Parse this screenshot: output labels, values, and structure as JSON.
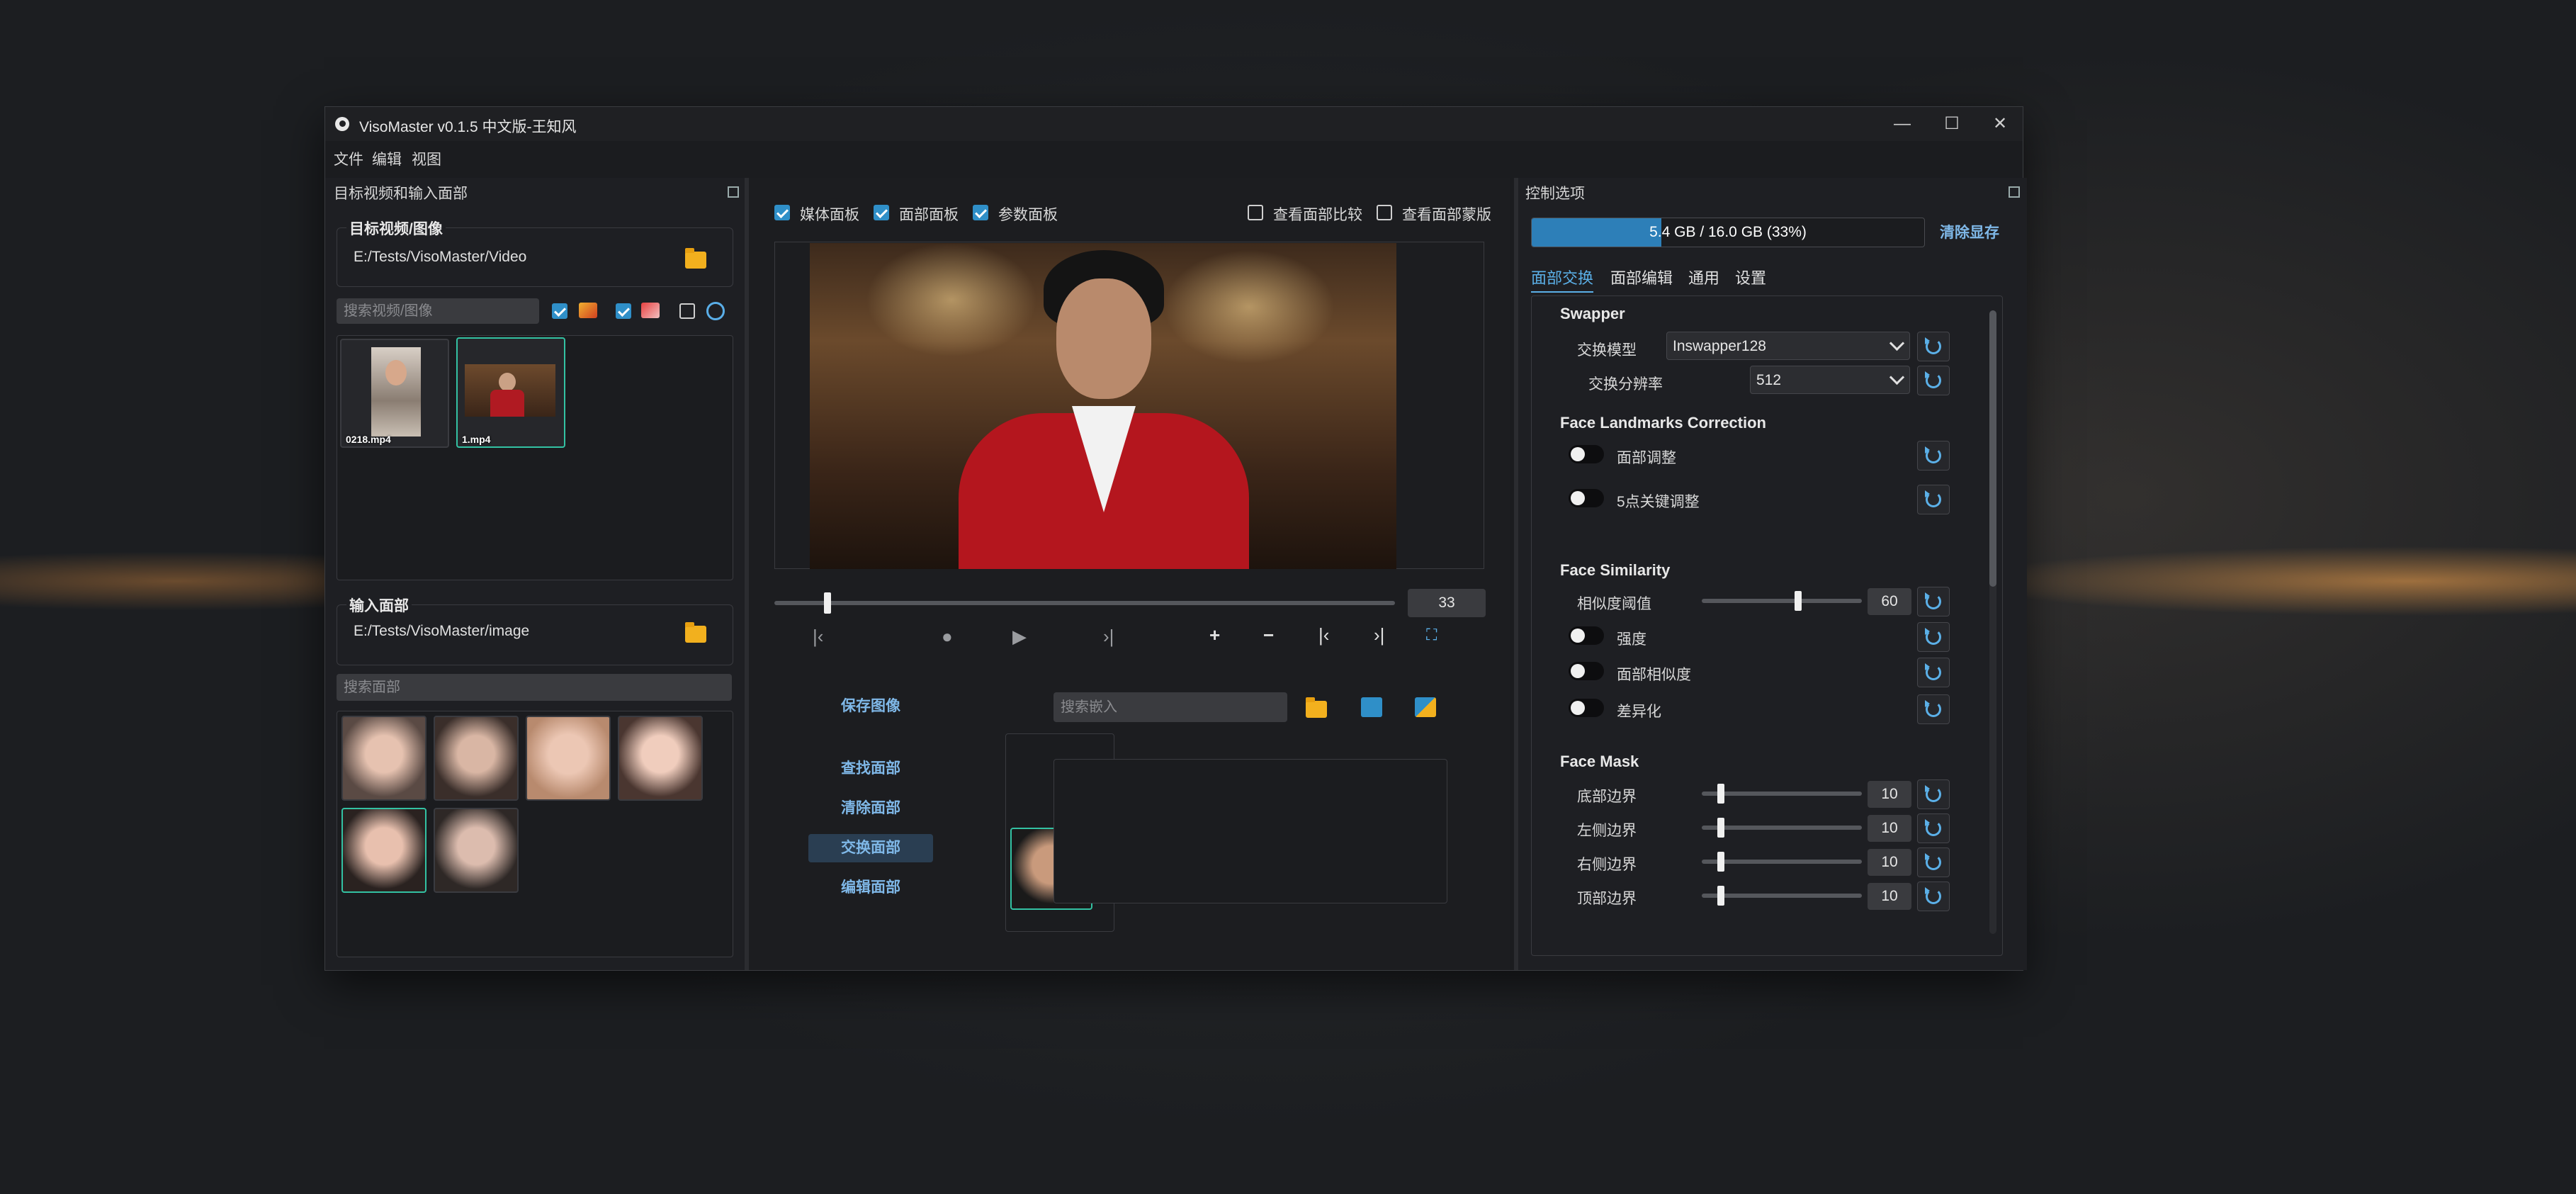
{
  "window": {
    "title": "VisoMaster v0.1.5 中文版-王知风",
    "minimize": "—",
    "maximize": "☐",
    "close": "✕"
  },
  "menu": [
    "文件",
    "编辑",
    "视图"
  ],
  "left_panel": {
    "header": "目标视频和输入面部",
    "target_group_title": "目标视频/图像",
    "target_path": "E:/Tests/VisoMaster/Video",
    "search_media_placeholder": "搜索视频/图像",
    "media_files": [
      {
        "name": "0218.mp4",
        "selected": false
      },
      {
        "name": "1.mp4",
        "selected": true
      }
    ],
    "input_group_title": "输入面部",
    "input_path": "E:/Tests/VisoMaster/image",
    "search_face_placeholder": "搜索面部"
  },
  "center_panel": {
    "checkboxes": [
      {
        "label": "媒体面板",
        "checked": true
      },
      {
        "label": "面部面板",
        "checked": true
      },
      {
        "label": "参数面板",
        "checked": true
      }
    ],
    "right_checkboxes": [
      {
        "label": "查看面部比较",
        "checked": false
      },
      {
        "label": "查看面部蒙版",
        "checked": false
      }
    ],
    "frame_number": "33",
    "frame_progress": 0.08,
    "save_image": "保存图像",
    "search_embed_placeholder": "搜索嵌入",
    "face_actions": [
      {
        "label": "查找面部",
        "selected": false
      },
      {
        "label": "清除面部",
        "selected": false
      },
      {
        "label": "交换面部",
        "selected": true
      },
      {
        "label": "编辑面部",
        "selected": false
      }
    ]
  },
  "right_panel": {
    "header": "控制选项",
    "vram_text": "5.4 GB / 16.0 GB (33%)",
    "vram_percent": 33,
    "clear_vram": "清除显存",
    "tabs": [
      "面部交换",
      "面部编辑",
      "通用",
      "设置"
    ],
    "swapper": {
      "title": "Swapper",
      "model_label": "交换模型",
      "model_value": "Inswapper128",
      "resolution_label": "交换分辨率",
      "resolution_value": "512"
    },
    "landmarks": {
      "title": "Face Landmarks Correction",
      "toggle1": "面部调整",
      "toggle2": "5点关键调整"
    },
    "similarity": {
      "title": "Face Similarity",
      "threshold_label": "相似度阈值",
      "threshold_value": "60",
      "threshold_fraction": 0.6,
      "toggle_strength": "强度",
      "toggle_face_sim": "面部相似度",
      "toggle_diff": "差异化"
    },
    "mask": {
      "title": "Face Mask",
      "rows": [
        {
          "label": "底部边界",
          "value": "10"
        },
        {
          "label": "左侧边界",
          "value": "10"
        },
        {
          "label": "右侧边界",
          "value": "10"
        },
        {
          "label": "顶部边界",
          "value": "10"
        }
      ]
    }
  }
}
